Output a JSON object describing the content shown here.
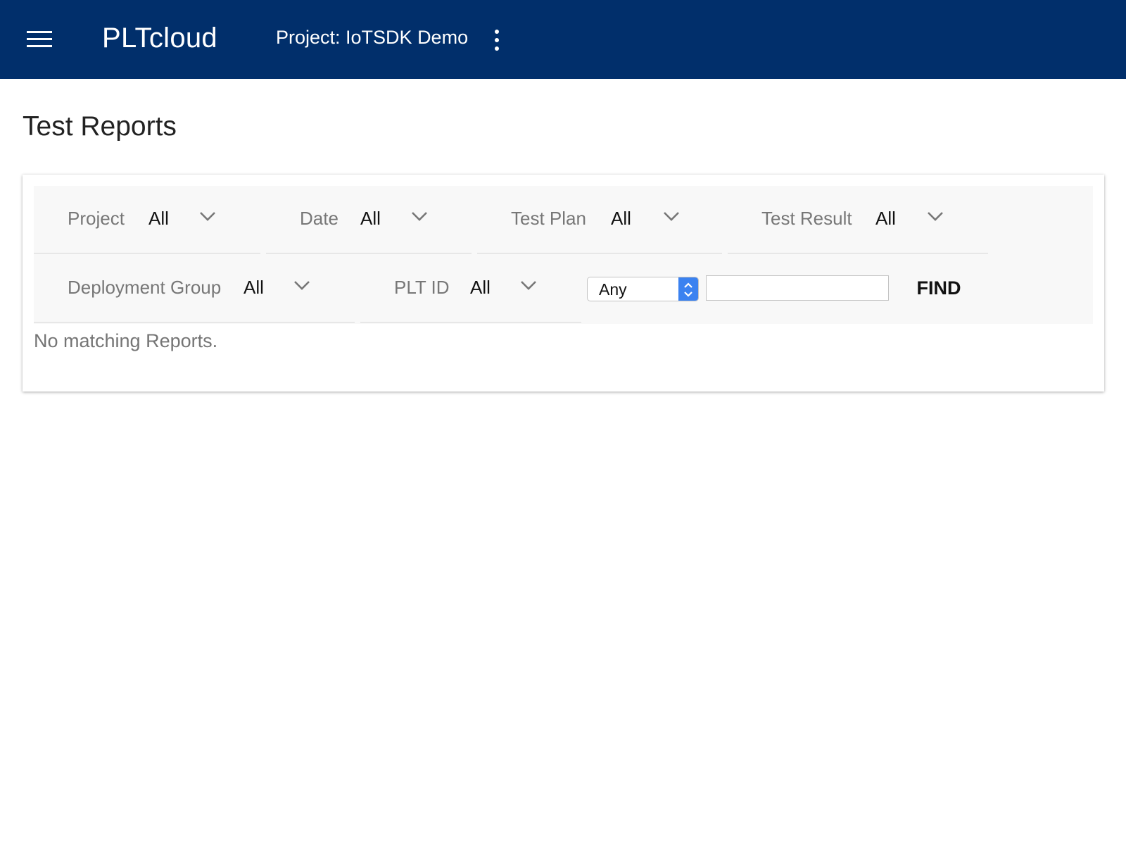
{
  "appbar": {
    "brand": "PLTcloud",
    "project_title": "Project: IoTSDK Demo",
    "background_color": "#012f6b",
    "menu_icon": "hamburger-menu-icon",
    "overflow_icon": "more-vertical-icon"
  },
  "page": {
    "title": "Test Reports"
  },
  "filters": {
    "project": {
      "label": "Project",
      "value": "All"
    },
    "date": {
      "label": "Date",
      "value": "All"
    },
    "test_plan": {
      "label": "Test Plan",
      "value": "All"
    },
    "test_result": {
      "label": "Test Result",
      "value": "All"
    },
    "deployment_group": {
      "label": "Deployment Group",
      "value": "All"
    },
    "plt_id": {
      "label": "PLT ID",
      "value": "All"
    }
  },
  "search": {
    "match_select_value": "Any",
    "input_value": "",
    "find_label": "FIND"
  },
  "results": {
    "empty_message": "No matching Reports."
  }
}
